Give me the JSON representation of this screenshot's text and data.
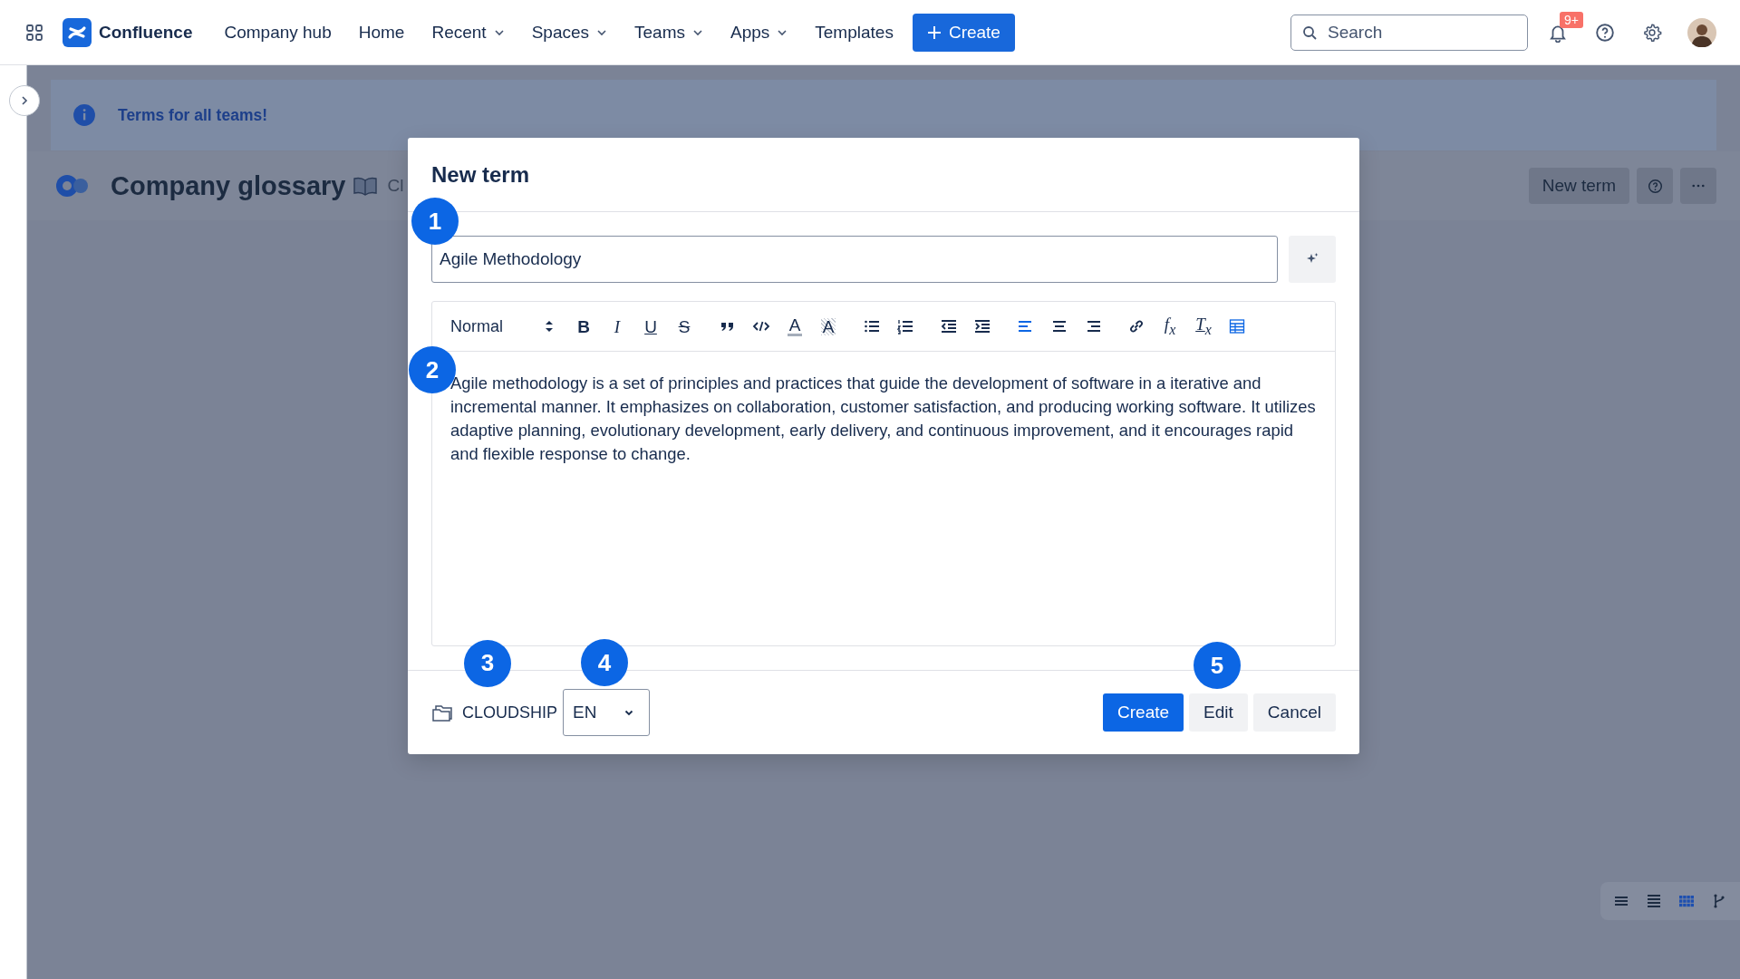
{
  "topbar": {
    "product": "Confluence",
    "nav": [
      {
        "label": "Company hub",
        "dropdown": false
      },
      {
        "label": "Home",
        "dropdown": false
      },
      {
        "label": "Recent",
        "dropdown": true
      },
      {
        "label": "Spaces",
        "dropdown": true
      },
      {
        "label": "Teams",
        "dropdown": true
      },
      {
        "label": "Apps",
        "dropdown": true
      },
      {
        "label": "Templates",
        "dropdown": false
      }
    ],
    "create": "Create",
    "search": {
      "placeholder": "Search"
    },
    "notifications": "9+"
  },
  "banner": {
    "text": "Terms for all teams!"
  },
  "page": {
    "title": "Company glossary",
    "subtitle": "Cl",
    "new_term": "New term"
  },
  "view_switcher": [
    {
      "kind": "compact",
      "selected": false
    },
    {
      "kind": "list",
      "selected": false
    },
    {
      "kind": "grid",
      "selected": true
    },
    {
      "kind": "tree",
      "selected": false
    }
  ],
  "dialog": {
    "title": "New term",
    "term": {
      "value": "Agile Methodology",
      "callout": "1"
    },
    "editor": {
      "style": "Normal",
      "callout": "2",
      "tools": [
        {
          "kind": "bold",
          "text": "B",
          "selected": false
        },
        {
          "kind": "italic",
          "text": "I",
          "selected": false
        },
        {
          "kind": "underline",
          "text": "U",
          "selected": false
        },
        {
          "kind": "strike",
          "text": "S",
          "selected": false
        },
        {
          "kind": "quote",
          "selected": false
        },
        {
          "kind": "code",
          "selected": false
        },
        {
          "kind": "color",
          "text": "A",
          "selected": false
        },
        {
          "kind": "highlight",
          "text": "A",
          "selected": false
        },
        {
          "kind": "bullets",
          "selected": false
        },
        {
          "kind": "numbered",
          "selected": false
        },
        {
          "kind": "outdent",
          "selected": false
        },
        {
          "kind": "indent",
          "selected": false
        },
        {
          "kind": "align-left",
          "selected": true
        },
        {
          "kind": "align-center",
          "selected": false
        },
        {
          "kind": "align-right",
          "selected": false
        },
        {
          "kind": "link",
          "selected": false
        },
        {
          "kind": "formula",
          "text": "f$_{x}$",
          "selected": false
        },
        {
          "kind": "clear",
          "text": "T$_{x}$",
          "selected": false
        },
        {
          "kind": "table",
          "selected": true
        }
      ],
      "text": "Agile methodology is a set of principles and practices that guide the development of software in a iterative and incremental manner. It emphasizes on collaboration, customer satisfaction, and producing working software. It utilizes adaptive planning, evolutionary development, early delivery, and continuous improvement, and it encourages rapid and flexible response to change."
    },
    "space": {
      "name": "CLOUDSHIP",
      "callout": "3"
    },
    "language": {
      "value": "EN",
      "callout": "4"
    },
    "buttons": [
      {
        "label": "Create",
        "kind": "primary"
      },
      {
        "label": "Edit",
        "kind": "default",
        "callout": "5"
      },
      {
        "label": "Cancel",
        "kind": "default"
      }
    ]
  }
}
